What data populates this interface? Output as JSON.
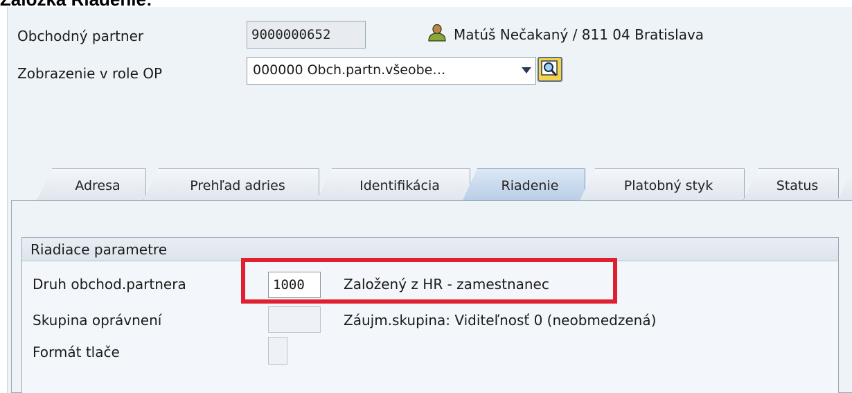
{
  "page_caption": "Záložka Riadenie:",
  "header": {
    "partner_label": "Obchodný partner",
    "partner_number": "9000000652",
    "partner_icon": "person-icon",
    "partner_description": "Matúš Nečakaný / 811 04 Bratislava",
    "role_label": "Zobrazenie v role OP",
    "role_value": "000000 Obch.partn.všeobe…",
    "search_icon": "search-icon"
  },
  "tabs": [
    {
      "label": "Adresa",
      "active": false
    },
    {
      "label": "Prehľad adries",
      "active": false
    },
    {
      "label": "Identifikácia",
      "active": false
    },
    {
      "label": "Riadenie",
      "active": true
    },
    {
      "label": "Platobný styk",
      "active": false
    },
    {
      "label": "Status",
      "active": false
    }
  ],
  "group": {
    "title": "Riadiace parametre",
    "rows": [
      {
        "label": "Druh obchod.partnera",
        "value": "1000",
        "description": "Založený z HR - zamestnanec"
      },
      {
        "label": "Skupina oprávnení",
        "value": "",
        "description": "Záujm.skupina: Viditeľnosť 0 (neobmedzená)"
      },
      {
        "label": "Formát tlače",
        "value": "",
        "description": ""
      }
    ]
  },
  "colors": {
    "highlight": "#e02030",
    "background": "#eef3f8",
    "active_tab": "#b8cde6"
  }
}
